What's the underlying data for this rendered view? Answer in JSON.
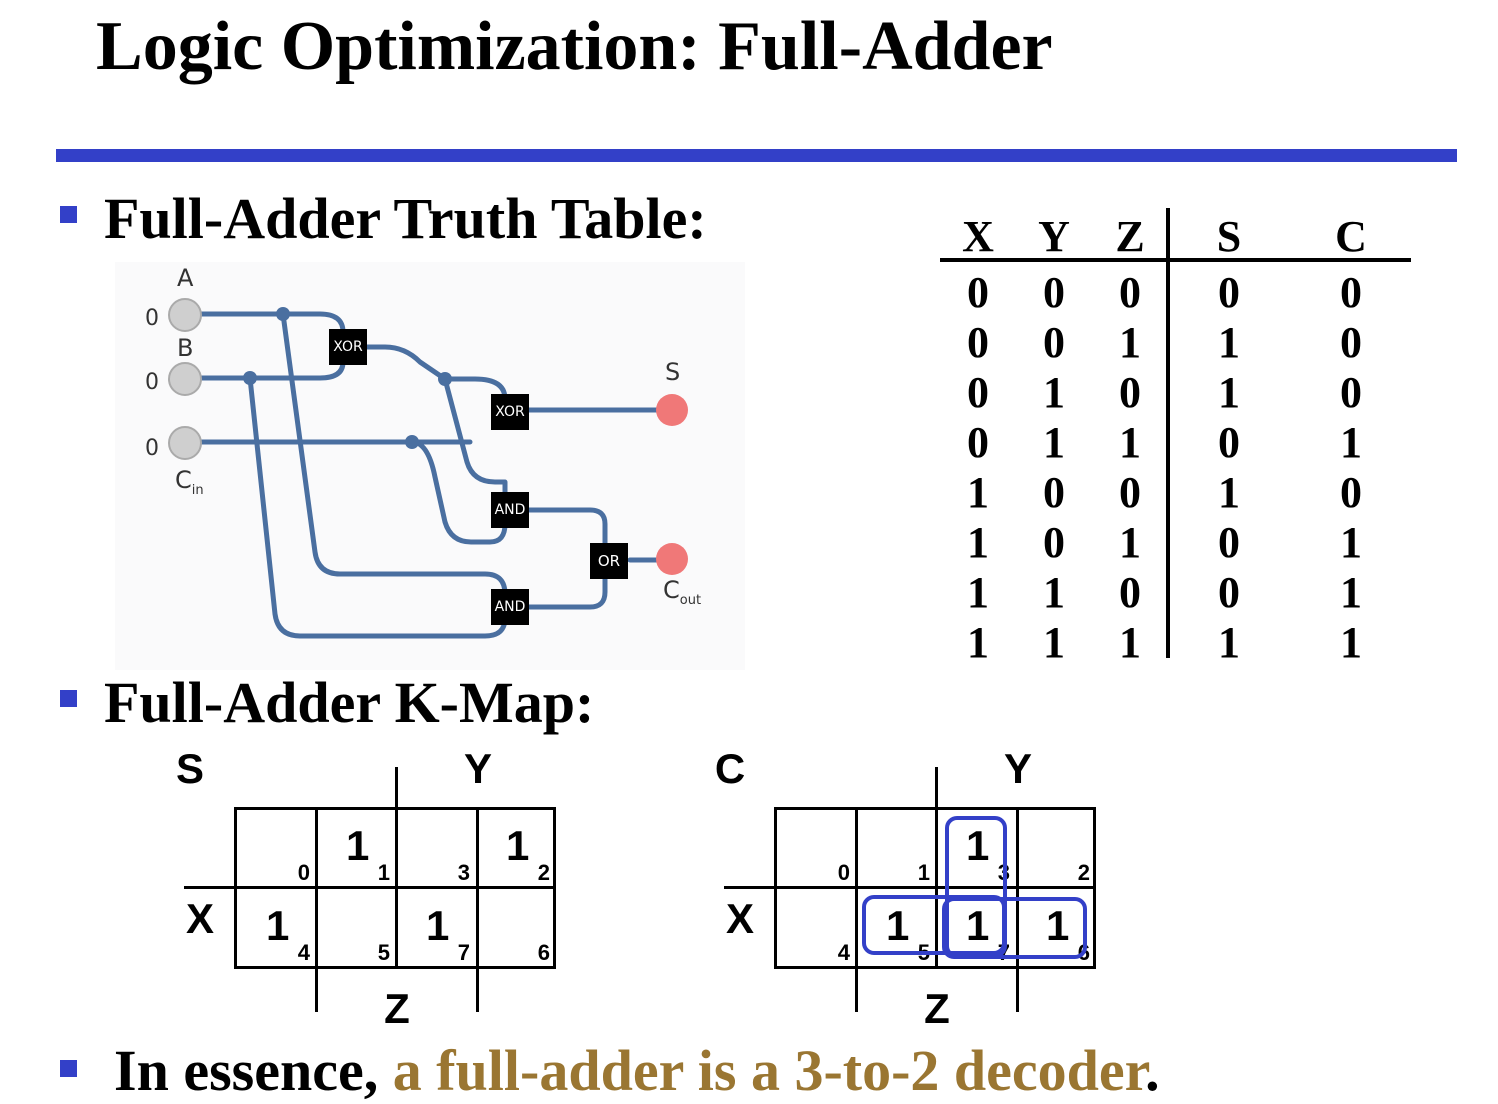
{
  "slide": {
    "title": "Logic Optimization: Full-Adder",
    "colors": {
      "rule": "#3340c8",
      "bullet": "#3340c8",
      "accent": "#9a7632",
      "wire": "#4a6fa0",
      "output_led": "#f07878"
    }
  },
  "bullets": {
    "truth_table_heading": "Full-Adder Truth Table:",
    "kmap_heading": "Full-Adder K-Map:",
    "essence_plain": "In essence, ",
    "essence_accent": "a full-adder is a 3-to-2 decoder",
    "essence_end": "."
  },
  "circuit": {
    "input_a_label": "A",
    "input_b_label": "B",
    "input_cin_label": "C",
    "input_cin_sub": "in",
    "input_a_value": "0",
    "input_b_value": "0",
    "input_cin_value": "0",
    "gate_xor1": "XOR",
    "gate_xor2": "XOR",
    "gate_and1": "AND",
    "gate_and2": "AND",
    "gate_or": "OR",
    "output_s_label": "S",
    "output_cout_label": "C",
    "output_cout_sub": "out"
  },
  "truth_table": {
    "headers": [
      "X",
      "Y",
      "Z",
      "S",
      "C"
    ],
    "rows": [
      [
        "0",
        "0",
        "0",
        "0",
        "0"
      ],
      [
        "0",
        "0",
        "1",
        "1",
        "0"
      ],
      [
        "0",
        "1",
        "0",
        "1",
        "0"
      ],
      [
        "0",
        "1",
        "1",
        "0",
        "1"
      ],
      [
        "1",
        "0",
        "0",
        "1",
        "0"
      ],
      [
        "1",
        "0",
        "1",
        "0",
        "1"
      ],
      [
        "1",
        "1",
        "0",
        "0",
        "1"
      ],
      [
        "1",
        "1",
        "1",
        "1",
        "1"
      ]
    ]
  },
  "kmap_s": {
    "name": "S",
    "var_y": "Y",
    "var_x": "X",
    "var_z": "Z",
    "cells": [
      {
        "value": "",
        "index": "0"
      },
      {
        "value": "1",
        "index": "1"
      },
      {
        "value": "",
        "index": "3"
      },
      {
        "value": "1",
        "index": "2"
      },
      {
        "value": "1",
        "index": "4"
      },
      {
        "value": "",
        "index": "5"
      },
      {
        "value": "1",
        "index": "7"
      },
      {
        "value": "",
        "index": "6"
      }
    ]
  },
  "kmap_c": {
    "name": "C",
    "var_y": "Y",
    "var_x": "X",
    "var_z": "Z",
    "cells": [
      {
        "value": "",
        "index": "0"
      },
      {
        "value": "",
        "index": "1"
      },
      {
        "value": "1",
        "index": "3"
      },
      {
        "value": "",
        "index": "2"
      },
      {
        "value": "",
        "index": "4"
      },
      {
        "value": "1",
        "index": "5"
      },
      {
        "value": "1",
        "index": "7"
      },
      {
        "value": "1",
        "index": "6"
      }
    ]
  }
}
